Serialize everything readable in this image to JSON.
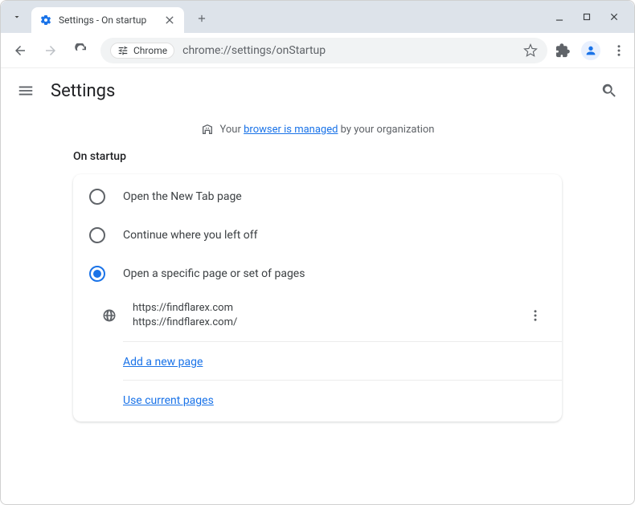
{
  "tab": {
    "title": "Settings - On startup"
  },
  "omnibox": {
    "chip_label": "Chrome",
    "url": "chrome://settings/onStartup"
  },
  "settings_header": {
    "title": "Settings"
  },
  "managed": {
    "prefix": "Your ",
    "link": "browser is managed",
    "suffix": " by your organization"
  },
  "section": {
    "title": "On startup"
  },
  "options": [
    {
      "label": "Open the New Tab page"
    },
    {
      "label": "Continue where you left off"
    },
    {
      "label": "Open a specific page or set of pages"
    }
  ],
  "startup_page": {
    "title": "https://findflarex.com",
    "url": "https://findflarex.com/"
  },
  "links": {
    "add": "Add a new page",
    "use_current": "Use current pages"
  }
}
